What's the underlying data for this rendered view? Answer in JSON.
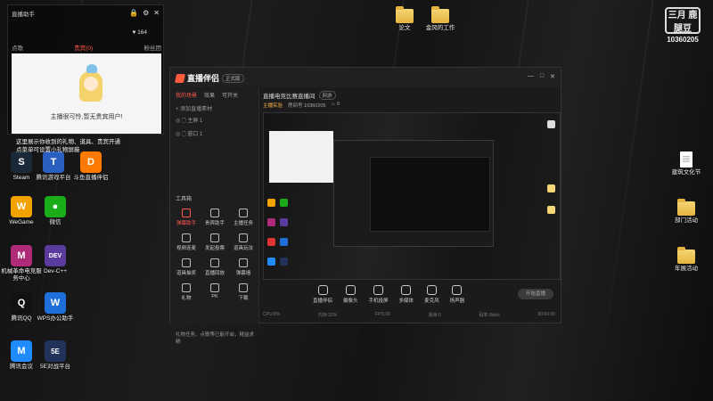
{
  "brand_watermark": {
    "logo_text": "三月 鹿腿豆",
    "room_number": "10360205"
  },
  "assistant_widget": {
    "title": "直播助手",
    "likes": "164",
    "tabs": [
      "点歌",
      "贵宾(0)",
      "粉丝团"
    ],
    "active_tab_index": 1,
    "empty_message": "主播很可怜,暂无贵宾用户!",
    "hint_text": "这里展示你收到的礼物、道具、贵宾开通\n点菜单可设置小礼物屏蔽"
  },
  "desktop_left": [
    {
      "label": "Steam",
      "color": "#1b2838",
      "glyph": "S"
    },
    {
      "label": "腾讯游戏平台",
      "color": "#2a5fbf",
      "glyph": "T"
    },
    {
      "label": "斗鱼直播伴侣",
      "color": "#ff7a00",
      "glyph": "D"
    },
    {
      "label": "WeGame",
      "color": "#f2a300",
      "glyph": "W"
    },
    {
      "label": "微信",
      "color": "#1aad19",
      "glyph": "💬"
    },
    {
      "label": "机械革命电竞服务中心",
      "color": "#b02a7a",
      "glyph": "M"
    },
    {
      "label": "Dev-C++",
      "color": "#5b3c9e",
      "glyph": "DEV"
    },
    {
      "label": "腾讯QQ",
      "color": "#111",
      "glyph": "Q"
    },
    {
      "label": "WPS办公助手",
      "color": "#1e6fd9",
      "glyph": "W"
    },
    {
      "label": "腾讯会议",
      "color": "#1f8bff",
      "glyph": "M"
    },
    {
      "label": "5E对战平台",
      "color": "#22325a",
      "glyph": "5E"
    }
  ],
  "desktop_top": [
    {
      "label": "论文"
    },
    {
      "label": "金冈的工作"
    }
  ],
  "desktop_right": [
    {
      "label": "建筑文化节"
    },
    {
      "label": "部门活动"
    },
    {
      "label": "年展活动"
    }
  ],
  "app": {
    "logo_title": "直播伴侣",
    "logo_badge": "正式版",
    "window_controls": [
      "—",
      "□",
      "✕"
    ],
    "left_tabs": [
      "我的场景",
      "效果",
      "可开关"
    ],
    "active_left_tab": 0,
    "sources": [
      "+ 添加直播素材",
      "◎ 🗋 主屏 1",
      "◎ 🗋 窗口 1"
    ],
    "toolbox_title": "工具箱",
    "tools": [
      "弹幕助手",
      "贵宾助手",
      "主播任务",
      "视频连麦",
      "发起投票",
      "道具玩法",
      "道具抽奖",
      "直播回放",
      "弹幕墙",
      "礼物",
      "PK",
      "下载"
    ],
    "bottom_tip": "礼物任务、点歌等已能开启，精益求精",
    "room_title": "直播电竞比赛直播间",
    "room_tag": "网游",
    "room_category": "主播实验",
    "room_meta": "房间号 10360205",
    "online": "0",
    "controls": [
      "直播伴侣",
      "摄像头",
      "手机投屏",
      "多媒体",
      "麦克风",
      "扬声器"
    ],
    "start_button": "开始直播",
    "status": [
      "CPU:8%",
      "内存:32%",
      "FPS:30",
      "丢帧:0",
      "码率:0kb/s",
      "00:00:00"
    ]
  }
}
